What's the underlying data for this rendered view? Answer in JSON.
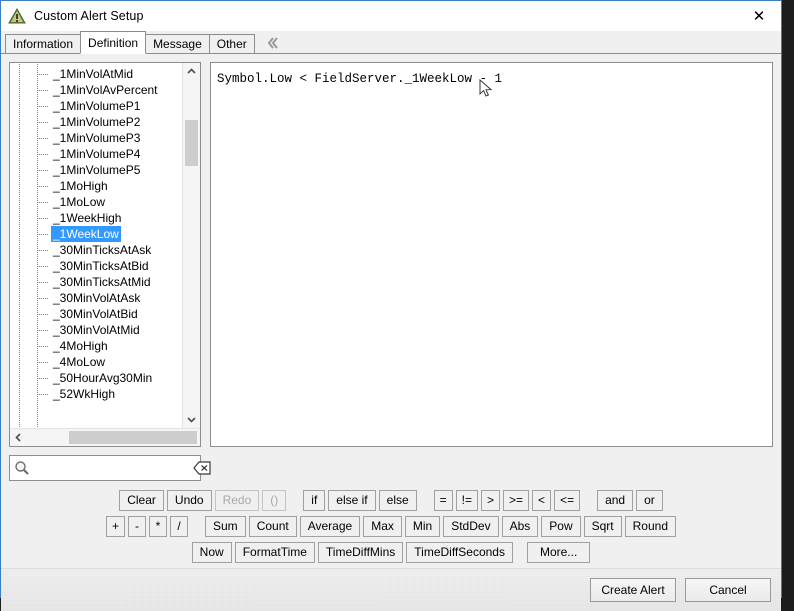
{
  "window": {
    "title": "Custom Alert Setup",
    "icon": "warning-triangle-icon",
    "close_label": "✕"
  },
  "tabs": {
    "items": [
      {
        "label": "Information",
        "active": false
      },
      {
        "label": "Definition",
        "active": true
      },
      {
        "label": "Message",
        "active": false
      },
      {
        "label": "Other",
        "active": false
      }
    ],
    "overflow_icon": "double-chevron-left-icon"
  },
  "tree": {
    "selected": "_1WeekLow",
    "items": [
      "_1MinVolAtMid",
      "_1MinVolAvPercent",
      "_1MinVolumeP1",
      "_1MinVolumeP2",
      "_1MinVolumeP3",
      "_1MinVolumeP4",
      "_1MinVolumeP5",
      "_1MoHigh",
      "_1MoLow",
      "_1WeekHigh",
      "_1WeekLow",
      "_30MinTicksAtAsk",
      "_30MinTicksAtBid",
      "_30MinTicksAtMid",
      "_30MinVolAtAsk",
      "_30MinVolAtBid",
      "_30MinVolAtMid",
      "_4MoHigh",
      "_4MoLow",
      "_50HourAvg30Min",
      "_52WkHigh"
    ],
    "scroll_up_icon": "chevron-up-icon",
    "scroll_down_icon": "chevron-down-icon",
    "scroll_left_icon": "chevron-left-icon",
    "scroll_right_icon": "chevron-right-icon"
  },
  "editor": {
    "formula": "Symbol.Low < FieldServer._1WeekLow - 1"
  },
  "search": {
    "value": "",
    "placeholder": "",
    "search_icon": "magnifier-icon",
    "clear_icon": "clear-backspace-icon"
  },
  "toolbar": {
    "row1_group1": [
      {
        "label": "Clear",
        "disabled": false
      },
      {
        "label": "Undo",
        "disabled": false
      },
      {
        "label": "Redo",
        "disabled": true
      },
      {
        "label": "()",
        "disabled": true
      }
    ],
    "row1_group2": [
      {
        "label": "if",
        "disabled": false
      },
      {
        "label": "else if",
        "disabled": false
      },
      {
        "label": "else",
        "disabled": false
      }
    ],
    "row1_group3": [
      {
        "label": "=",
        "disabled": false
      },
      {
        "label": "!=",
        "disabled": false
      },
      {
        "label": ">",
        "disabled": false
      },
      {
        "label": ">=",
        "disabled": false
      },
      {
        "label": "<",
        "disabled": false
      },
      {
        "label": "<=",
        "disabled": false
      }
    ],
    "row1_group4": [
      {
        "label": "and",
        "disabled": false
      },
      {
        "label": "or",
        "disabled": false
      }
    ],
    "row2_group1": [
      {
        "label": "+",
        "disabled": false
      },
      {
        "label": "-",
        "disabled": false
      },
      {
        "label": "*",
        "disabled": false
      },
      {
        "label": "/",
        "disabled": false
      }
    ],
    "row2_group2": [
      {
        "label": "Sum",
        "disabled": false
      },
      {
        "label": "Count",
        "disabled": false
      },
      {
        "label": "Average",
        "disabled": false
      },
      {
        "label": "Max",
        "disabled": false
      },
      {
        "label": "Min",
        "disabled": false
      },
      {
        "label": "StdDev",
        "disabled": false
      },
      {
        "label": "Abs",
        "disabled": false
      },
      {
        "label": "Pow",
        "disabled": false
      },
      {
        "label": "Sqrt",
        "disabled": false
      },
      {
        "label": "Round",
        "disabled": false
      }
    ],
    "row3_group1": [
      {
        "label": "Now",
        "disabled": false
      },
      {
        "label": "FormatTime",
        "disabled": false
      },
      {
        "label": "TimeDiffMins",
        "disabled": false
      },
      {
        "label": "TimeDiffSeconds",
        "disabled": false
      }
    ],
    "row3_group2": [
      {
        "label": "More...",
        "disabled": false
      }
    ]
  },
  "footer": {
    "create_label": "Create Alert",
    "cancel_label": "Cancel"
  },
  "colors": {
    "accent": "#3399ff",
    "window_border": "#3a7fc1",
    "panel_bg": "#f0f0f0"
  }
}
